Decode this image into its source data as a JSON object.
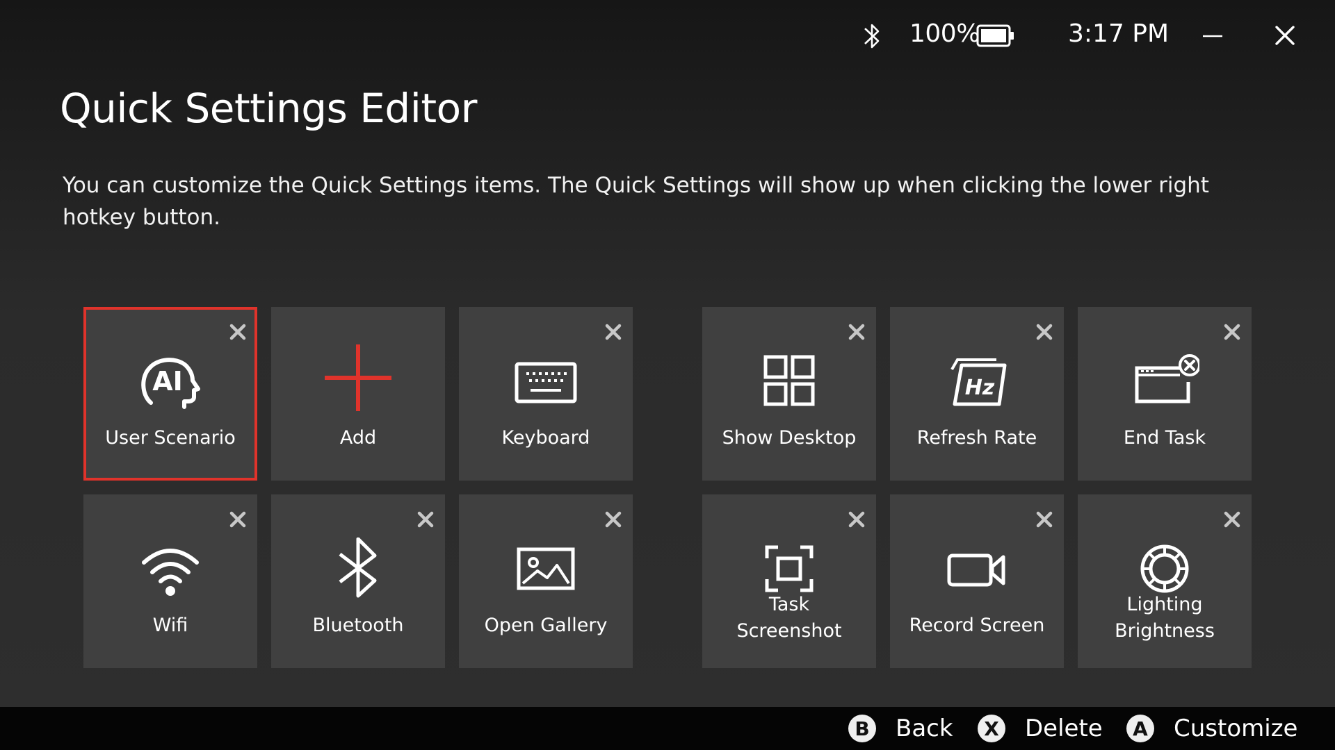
{
  "status": {
    "battery_percent": "100%",
    "battery_level": 1.0,
    "time": "3:17 PM"
  },
  "title": "Quick Settings Editor",
  "description": "You can customize the Quick Settings items. The Quick Settings will show up when clicking the lower right hotkey button.",
  "accent_color": "#e0332b",
  "tiles": [
    {
      "label": "User Scenario",
      "icon": "ai-head-icon",
      "selected": true,
      "removable": true
    },
    {
      "label": "Add",
      "icon": "plus-icon",
      "selected": false,
      "removable": false
    },
    {
      "label": "Keyboard",
      "icon": "keyboard-icon",
      "selected": false,
      "removable": true
    },
    {
      "label": "Show Desktop",
      "icon": "grid-icon",
      "selected": false,
      "removable": true
    },
    {
      "label": "Refresh Rate",
      "icon": "refresh-rate-icon",
      "icon_text": "Hz",
      "selected": false,
      "removable": true
    },
    {
      "label": "End Task",
      "icon": "end-task-icon",
      "selected": false,
      "removable": true
    },
    {
      "label": "Wifi",
      "icon": "wifi-icon",
      "selected": false,
      "removable": true
    },
    {
      "label": "Bluetooth",
      "icon": "bluetooth-icon",
      "selected": false,
      "removable": true
    },
    {
      "label": "Open Gallery",
      "icon": "image-icon",
      "selected": false,
      "removable": true
    },
    {
      "label_line1": "Task",
      "label_line2": "Screenshot",
      "icon": "screenshot-icon",
      "selected": false,
      "removable": true
    },
    {
      "label": "Record Screen",
      "icon": "video-camera-icon",
      "selected": false,
      "removable": true
    },
    {
      "label_line1": "Lighting",
      "label_line2": "Brightness",
      "icon": "lighting-ring-icon",
      "selected": false,
      "removable": true
    }
  ],
  "footer": {
    "back": {
      "glyph": "B",
      "label": "Back"
    },
    "delete": {
      "glyph": "X",
      "label": "Delete"
    },
    "customize": {
      "glyph": "A",
      "label": "Customize"
    }
  }
}
